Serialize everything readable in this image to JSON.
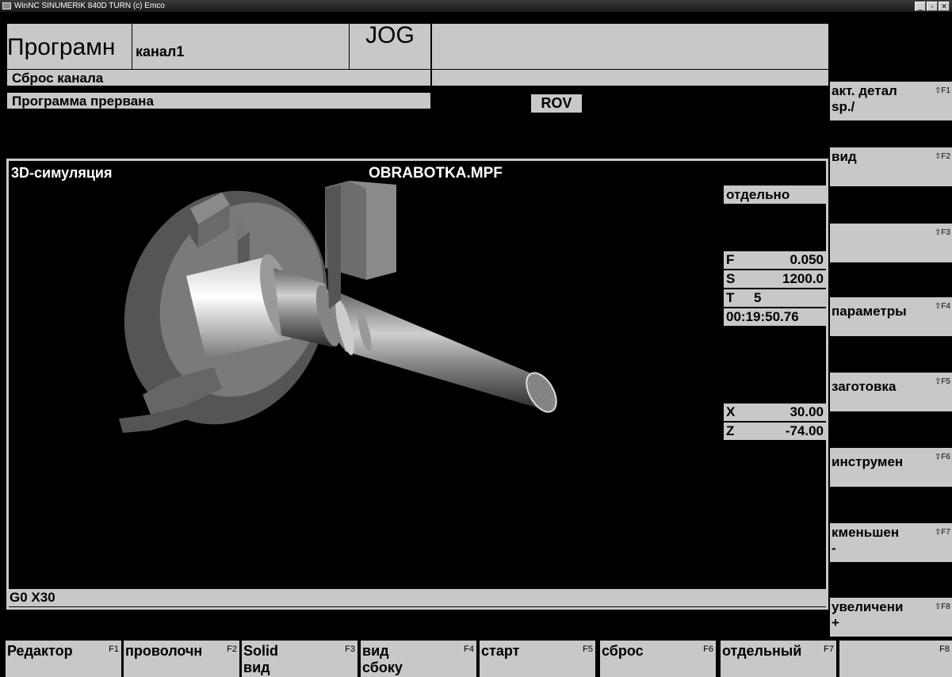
{
  "window": {
    "title": "WinNC SINUMERIK 840D TURN (c) Emco",
    "buttons": [
      "minimize-icon",
      "maximize-icon",
      "close-icon"
    ]
  },
  "header": {
    "program_title": "Програмн",
    "channel": "канал1",
    "mode": "JOG",
    "channel_reset": "Сброс канала",
    "program_status": "Программа прервана",
    "rov": "ROV"
  },
  "simulation": {
    "title": "3D-симуляция",
    "file": "OBRABOTKA.MPF",
    "view_mode": "отдельно",
    "feed_label": "F",
    "feed_value": "0.050",
    "spindle_label": "S",
    "spindle_value": "1200.0",
    "tool_label": "T",
    "tool_value": "5",
    "time": "00:19:50.76",
    "x_label": "X",
    "x_value": "30.00",
    "z_label": "Z",
    "z_value": "-74.00",
    "current_block": "G0 X30"
  },
  "right_softkeys": [
    {
      "line1": "акт. детал",
      "line2": "sp./",
      "fkey": "⇧F1"
    },
    {
      "line1": "вид",
      "line2": "",
      "fkey": "⇧F2"
    },
    {
      "line1": "",
      "line2": "",
      "fkey": "⇧F3"
    },
    {
      "line1": "параметры",
      "line2": "",
      "fkey": "⇧F4"
    },
    {
      "line1": "заготовка",
      "line2": "",
      "fkey": "⇧F5"
    },
    {
      "line1": "инструмен",
      "line2": "",
      "fkey": "⇧F6"
    },
    {
      "line1": "кменьшен",
      "line2": "-",
      "fkey": "⇧F7"
    },
    {
      "line1": "увеличени",
      "line2": "+",
      "fkey": "⇧F8"
    }
  ],
  "bottom_softkeys": [
    {
      "line1": "Редактор",
      "line2": "",
      "fkey": "F1"
    },
    {
      "line1": "проволочн",
      "line2": "",
      "fkey": "F2"
    },
    {
      "line1": "Solid",
      "line2": "вид",
      "fkey": "F3"
    },
    {
      "line1": "вид",
      "line2": "сбоку",
      "fkey": "F4"
    },
    {
      "line1": "старт",
      "line2": "",
      "fkey": "F5"
    },
    {
      "line1": "сброс",
      "line2": "",
      "fkey": "F6"
    },
    {
      "line1": "отдельный",
      "line2": "",
      "fkey": "F7"
    },
    {
      "line1": "",
      "line2": "",
      "fkey": "F8"
    }
  ]
}
